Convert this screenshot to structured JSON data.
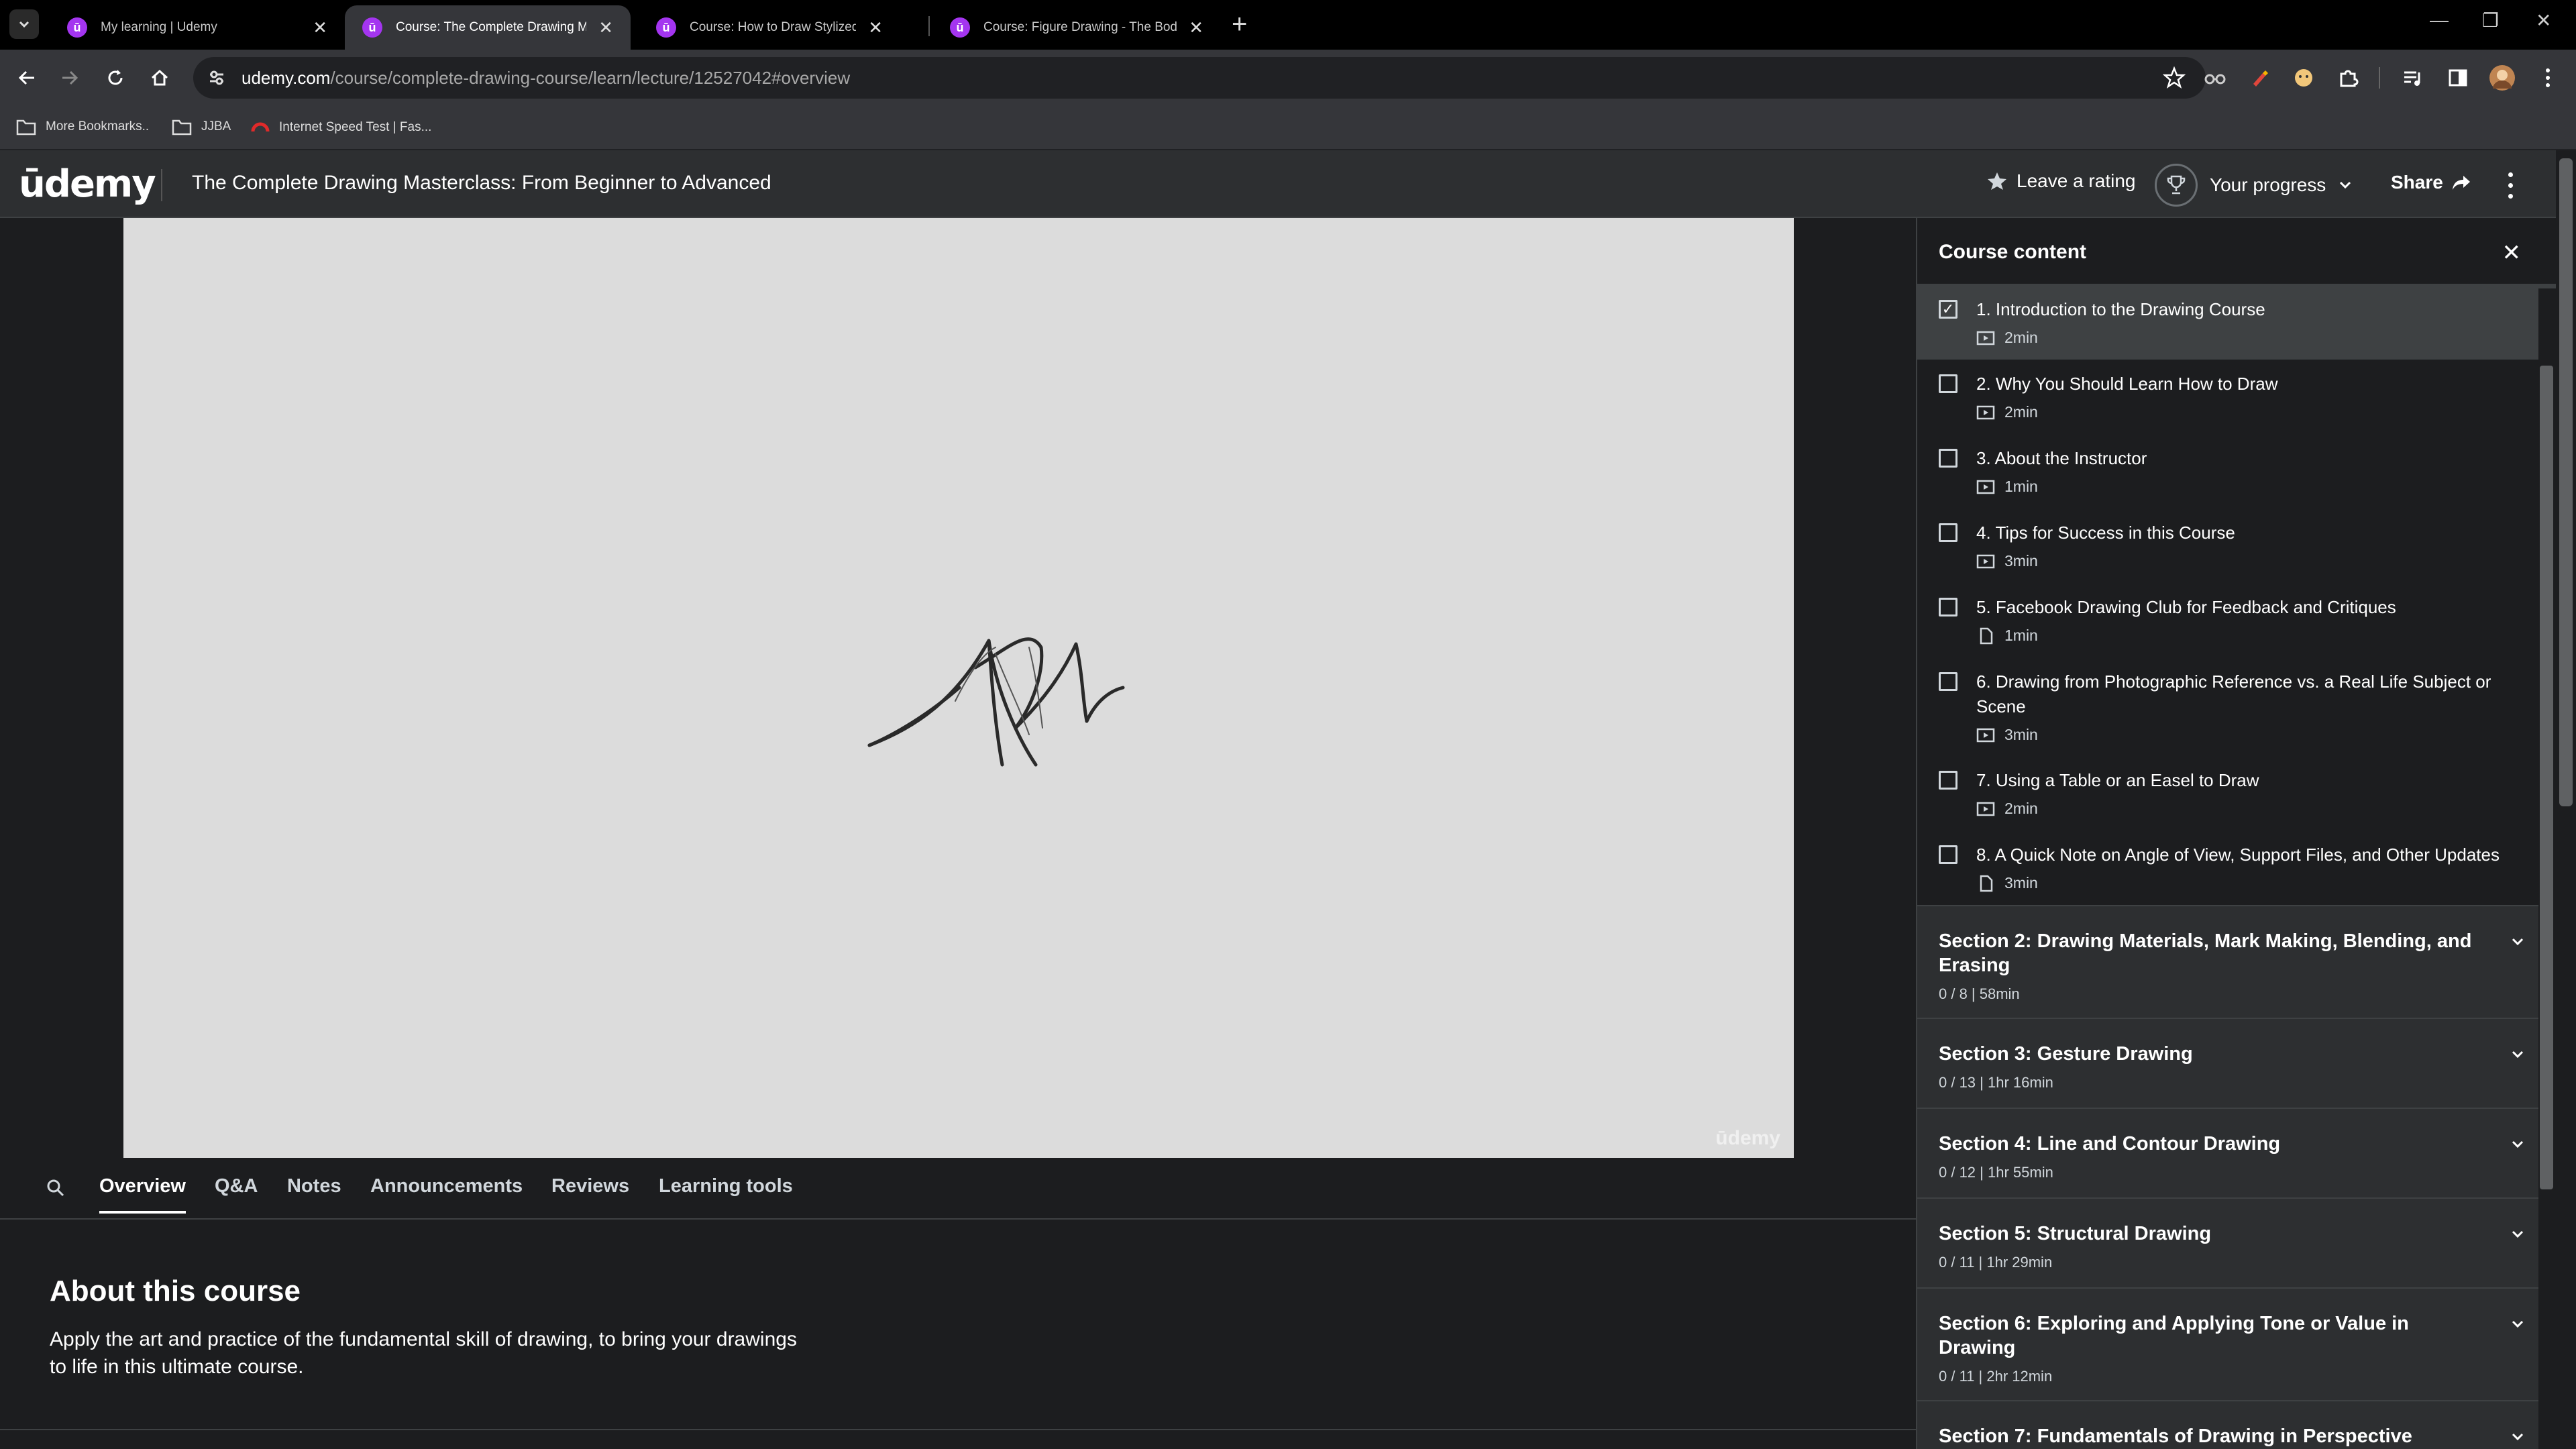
{
  "browser": {
    "tabs": [
      {
        "title": "My learning | Udemy",
        "active": false
      },
      {
        "title": "Course: The Complete Drawing Maste",
        "active": true
      },
      {
        "title": "Course: How to Draw Stylized Poses a",
        "active": false
      },
      {
        "title": "Course: Figure Drawing - The Body in",
        "active": false
      }
    ],
    "url_host": "udemy.com",
    "url_path": "/course/complete-drawing-course/learn/lecture/12527042#overview",
    "bookmarks": [
      {
        "label": "More Bookmarks..",
        "icon": "folder-icon"
      },
      {
        "label": "JJBA",
        "icon": "folder-icon"
      },
      {
        "label": "Internet Speed Test | Fas...",
        "icon": "speedtest-icon"
      }
    ]
  },
  "header": {
    "logo": "ūdemy",
    "course_title": "The Complete Drawing Masterclass: From Beginner to Advanced",
    "rating_label": "Leave a rating",
    "progress_label": "Your progress",
    "share_label": "Share"
  },
  "video": {
    "watermark": "ūdemy"
  },
  "course_tabs": [
    "Overview",
    "Q&A",
    "Notes",
    "Announcements",
    "Reviews",
    "Learning tools"
  ],
  "about": {
    "title": "About this course",
    "text": "Apply the art and practice of the fundamental skill of drawing, to bring your drawings to life in this ultimate course."
  },
  "sidebar": {
    "title": "Course content",
    "lectures": [
      {
        "title": "1. Introduction to the Drawing Course",
        "duration": "2min",
        "type": "video",
        "checked": true
      },
      {
        "title": "2. Why You Should Learn How to Draw",
        "duration": "2min",
        "type": "video",
        "checked": false
      },
      {
        "title": "3. About the Instructor",
        "duration": "1min",
        "type": "video",
        "checked": false
      },
      {
        "title": "4. Tips for Success in this Course",
        "duration": "3min",
        "type": "video",
        "checked": false
      },
      {
        "title": "5. Facebook Drawing Club for Feedback and Critiques",
        "duration": "1min",
        "type": "file",
        "checked": false
      },
      {
        "title": "6. Drawing from Photographic Reference vs. a Real Life Subject or Scene",
        "duration": "3min",
        "type": "video",
        "checked": false
      },
      {
        "title": "7. Using a Table or an Easel to Draw",
        "duration": "2min",
        "type": "video",
        "checked": false
      },
      {
        "title": "8. A Quick Note on Angle of View, Support Files, and Other Updates",
        "duration": "3min",
        "type": "file",
        "checked": false
      }
    ],
    "sections": [
      {
        "title": "Section 2: Drawing Materials, Mark Making, Blending, and Erasing",
        "meta": "0 / 8 | 58min"
      },
      {
        "title": "Section 3: Gesture Drawing",
        "meta": "0 / 13 | 1hr 16min"
      },
      {
        "title": "Section 4: Line and Contour Drawing",
        "meta": "0 / 12 | 1hr 55min"
      },
      {
        "title": "Section 5: Structural Drawing",
        "meta": "0 / 11 | 1hr 29min"
      },
      {
        "title": "Section 6: Exploring and Applying Tone or Value in Drawing",
        "meta": "0 / 11 | 2hr 12min"
      },
      {
        "title": "Section 7: Fundamentals of Drawing in Perspective",
        "meta": ""
      }
    ]
  },
  "colors": {
    "brand": "#a435f0",
    "header_bg": "#2d2f31",
    "page_bg": "#1c1d1f"
  }
}
